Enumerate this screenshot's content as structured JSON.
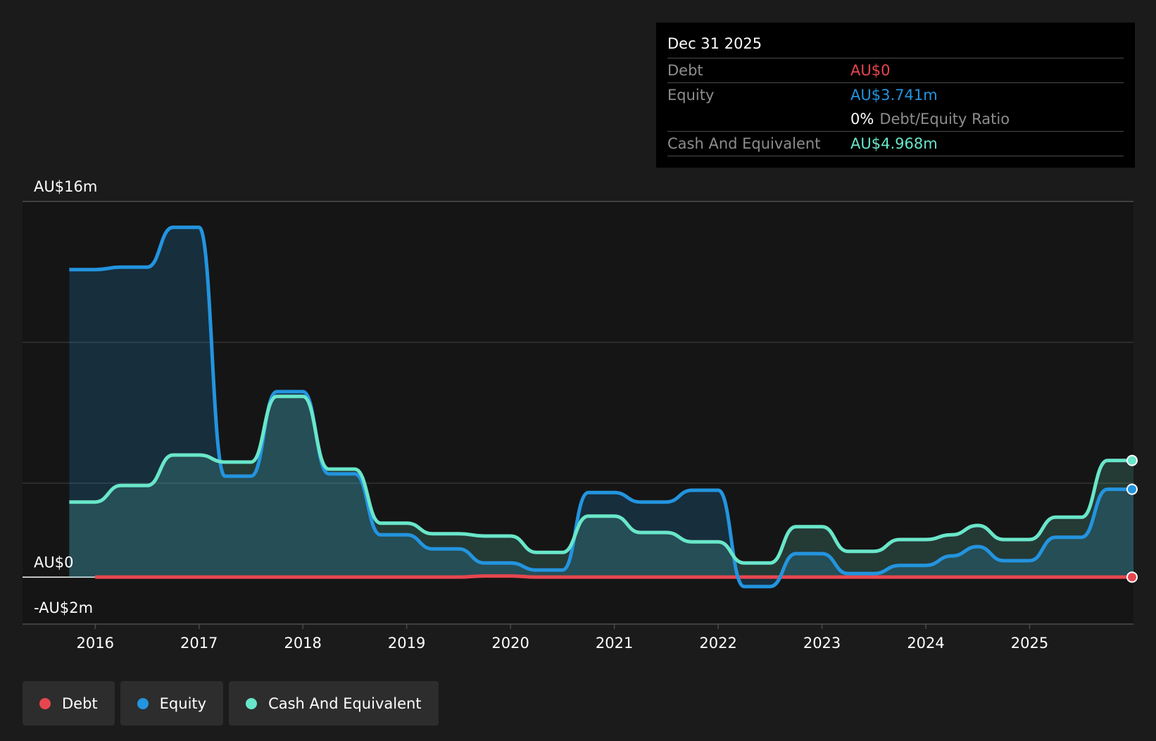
{
  "colors": {
    "debt": "#e6474f",
    "equity": "#2394df",
    "cash": "#69e6c9",
    "background": "#1b1b1b",
    "plot_background": "#151515"
  },
  "tooltip": {
    "date": "Dec 31 2025",
    "debt_label": "Debt",
    "debt_value": "AU$0",
    "equity_label": "Equity",
    "equity_value": "AU$3.741m",
    "ratio_value": "0%",
    "ratio_label": "Debt/Equity Ratio",
    "cash_label": "Cash And Equivalent",
    "cash_value": "AU$4.968m"
  },
  "legend": [
    {
      "label": "Debt",
      "color": "#e6474f"
    },
    {
      "label": "Equity",
      "color": "#2394df"
    },
    {
      "label": "Cash And Equivalent",
      "color": "#69e6c9"
    }
  ],
  "chart_data": {
    "type": "area",
    "y_tick_labels": [
      {
        "value": 16,
        "label": "AU$16m"
      },
      {
        "value": 0,
        "label": "AU$0"
      },
      {
        "value": -2,
        "label": "-AU$2m"
      }
    ],
    "ylim": [
      -2,
      16
    ],
    "xlim": [
      2015.3,
      2026.0
    ],
    "x_ticks": [
      2016,
      2017,
      2018,
      2019,
      2020,
      2021,
      2022,
      2023,
      2024,
      2025
    ],
    "series": [
      {
        "name": "Debt",
        "color": "#e6474f",
        "points": [
          [
            2016.0,
            0
          ],
          [
            2019.5,
            0
          ],
          [
            2019.75,
            0.05
          ],
          [
            2020.0,
            0.05
          ],
          [
            2020.25,
            0
          ],
          [
            2026.0,
            0
          ]
        ]
      },
      {
        "name": "Equity",
        "color": "#2394df",
        "points": [
          [
            2015.75,
            13.1
          ],
          [
            2016.0,
            13.1
          ],
          [
            2016.25,
            13.2
          ],
          [
            2016.5,
            13.2
          ],
          [
            2016.75,
            14.9
          ],
          [
            2017.0,
            14.9
          ],
          [
            2017.25,
            4.3
          ],
          [
            2017.5,
            4.3
          ],
          [
            2017.75,
            7.9
          ],
          [
            2018.0,
            7.9
          ],
          [
            2018.25,
            4.4
          ],
          [
            2018.5,
            4.4
          ],
          [
            2018.75,
            1.8
          ],
          [
            2019.0,
            1.8
          ],
          [
            2019.25,
            1.2
          ],
          [
            2019.5,
            1.2
          ],
          [
            2019.75,
            0.6
          ],
          [
            2020.0,
            0.6
          ],
          [
            2020.25,
            0.3
          ],
          [
            2020.5,
            0.3
          ],
          [
            2020.75,
            3.6
          ],
          [
            2021.0,
            3.6
          ],
          [
            2021.25,
            3.2
          ],
          [
            2021.5,
            3.2
          ],
          [
            2021.75,
            3.7
          ],
          [
            2022.0,
            3.7
          ],
          [
            2022.25,
            -0.4
          ],
          [
            2022.5,
            -0.4
          ],
          [
            2022.75,
            1.0
          ],
          [
            2023.0,
            1.0
          ],
          [
            2023.25,
            0.15
          ],
          [
            2023.5,
            0.15
          ],
          [
            2023.75,
            0.5
          ],
          [
            2024.0,
            0.5
          ],
          [
            2024.25,
            0.9
          ],
          [
            2024.5,
            1.3
          ],
          [
            2024.75,
            0.7
          ],
          [
            2025.0,
            0.7
          ],
          [
            2025.25,
            1.7
          ],
          [
            2025.5,
            1.7
          ],
          [
            2025.75,
            3.741
          ],
          [
            2026.0,
            3.741
          ]
        ]
      },
      {
        "name": "Cash And Equivalent",
        "color": "#69e6c9",
        "points": [
          [
            2015.75,
            3.2
          ],
          [
            2016.0,
            3.2
          ],
          [
            2016.25,
            3.9
          ],
          [
            2016.5,
            3.9
          ],
          [
            2016.75,
            5.2
          ],
          [
            2017.0,
            5.2
          ],
          [
            2017.25,
            4.9
          ],
          [
            2017.5,
            4.9
          ],
          [
            2017.75,
            7.7
          ],
          [
            2018.0,
            7.7
          ],
          [
            2018.25,
            4.6
          ],
          [
            2018.5,
            4.6
          ],
          [
            2018.75,
            2.3
          ],
          [
            2019.0,
            2.3
          ],
          [
            2019.25,
            1.85
          ],
          [
            2019.5,
            1.85
          ],
          [
            2019.75,
            1.75
          ],
          [
            2020.0,
            1.75
          ],
          [
            2020.25,
            1.05
          ],
          [
            2020.5,
            1.05
          ],
          [
            2020.75,
            2.6
          ],
          [
            2021.0,
            2.6
          ],
          [
            2021.25,
            1.9
          ],
          [
            2021.5,
            1.9
          ],
          [
            2021.75,
            1.5
          ],
          [
            2022.0,
            1.5
          ],
          [
            2022.25,
            0.6
          ],
          [
            2022.5,
            0.6
          ],
          [
            2022.75,
            2.15
          ],
          [
            2023.0,
            2.15
          ],
          [
            2023.25,
            1.1
          ],
          [
            2023.5,
            1.1
          ],
          [
            2023.75,
            1.6
          ],
          [
            2024.0,
            1.6
          ],
          [
            2024.25,
            1.8
          ],
          [
            2024.5,
            2.2
          ],
          [
            2024.75,
            1.6
          ],
          [
            2025.0,
            1.6
          ],
          [
            2025.25,
            2.55
          ],
          [
            2025.5,
            2.55
          ],
          [
            2025.75,
            4.968
          ],
          [
            2026.0,
            4.968
          ]
        ]
      }
    ]
  }
}
